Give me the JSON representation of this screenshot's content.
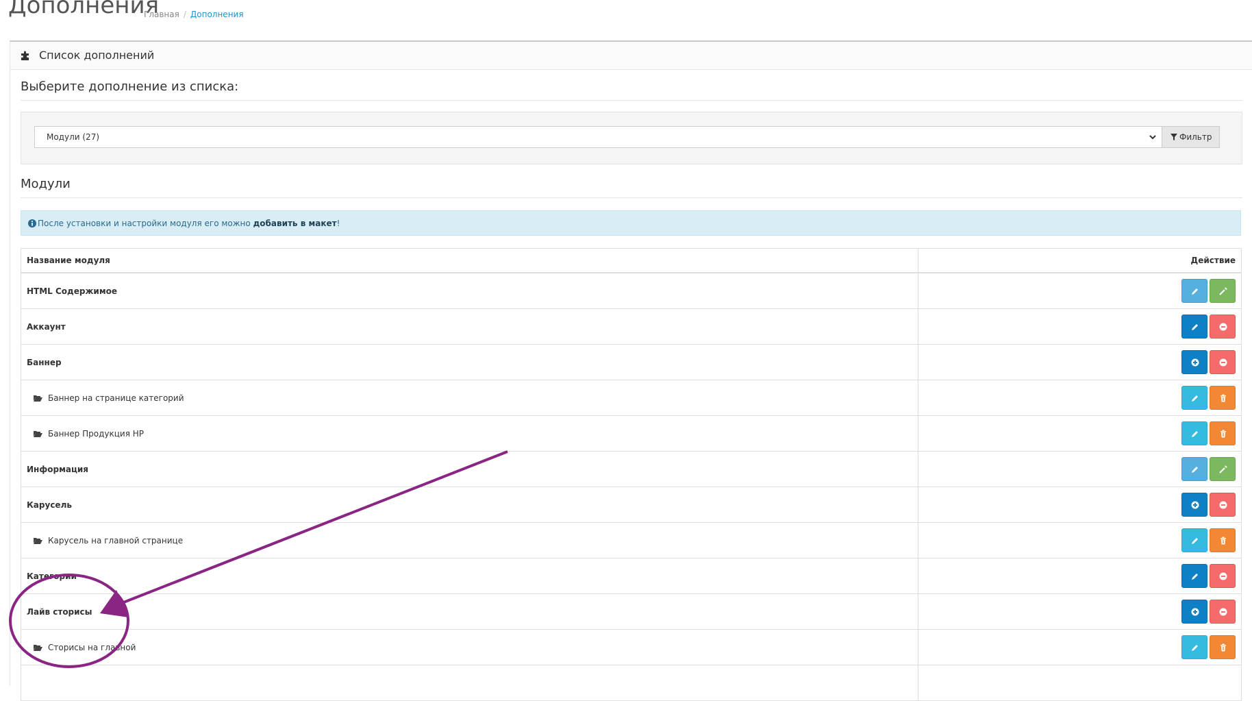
{
  "page": {
    "title": "Дополнения",
    "breadcrumb": [
      "Главная",
      "Дополнения"
    ]
  },
  "panel": {
    "heading": "Список дополнений",
    "heading_icon": "puzzle-icon"
  },
  "chooser": {
    "legend": "Выберите дополнение из списка:",
    "select_value": "Модули (27)",
    "filter_label": "Фильтр",
    "filter_icon": "filter-icon"
  },
  "section": {
    "title": "Модули"
  },
  "alert": {
    "icon": "info-circle-icon",
    "text_before": "После установки и настройки модуля его можно ",
    "text_link": "добавить в макет",
    "text_after": "!"
  },
  "table": {
    "headers": [
      "Название модуля",
      "Действие"
    ],
    "rows": [
      {
        "name": "HTML Содержимое",
        "type": "parent",
        "actions": [
          "edit-light",
          "wand"
        ]
      },
      {
        "name": "Аккаунт",
        "type": "parent",
        "actions": [
          "edit-dark",
          "remove"
        ]
      },
      {
        "name": "Баннер",
        "type": "parent",
        "actions": [
          "install",
          "remove"
        ]
      },
      {
        "name": "Баннер на странице категорий",
        "type": "child",
        "actions": [
          "edit-cyan",
          "delete"
        ]
      },
      {
        "name": "Баннер Продукция HP",
        "type": "child",
        "actions": [
          "edit-cyan",
          "delete"
        ]
      },
      {
        "name": "Информация",
        "type": "parent",
        "actions": [
          "edit-light",
          "wand"
        ]
      },
      {
        "name": "Карусель",
        "type": "parent",
        "actions": [
          "install",
          "remove"
        ]
      },
      {
        "name": "Карусель на главной странице",
        "type": "child",
        "actions": [
          "edit-cyan",
          "delete"
        ]
      },
      {
        "name": "Категории",
        "type": "parent",
        "actions": [
          "edit-dark",
          "remove"
        ]
      },
      {
        "name": "Лайв сторисы",
        "type": "parent",
        "actions": [
          "install",
          "remove"
        ]
      },
      {
        "name": "Сторисы на главной",
        "type": "child",
        "actions": [
          "edit-cyan",
          "delete"
        ]
      },
      {
        "name": "",
        "type": "parent",
        "actions": []
      }
    ]
  },
  "annotation": {
    "color": "#8a2583"
  },
  "colors": {
    "edit_light": "#56b0dd",
    "wand": "#7cb860",
    "edit_dark": "#0d80c6",
    "remove": "#f56b6b",
    "edit_cyan": "#35bbe0",
    "delete": "#f38733",
    "link": "#1e91cf",
    "alert_bg": "#d9edf7"
  }
}
